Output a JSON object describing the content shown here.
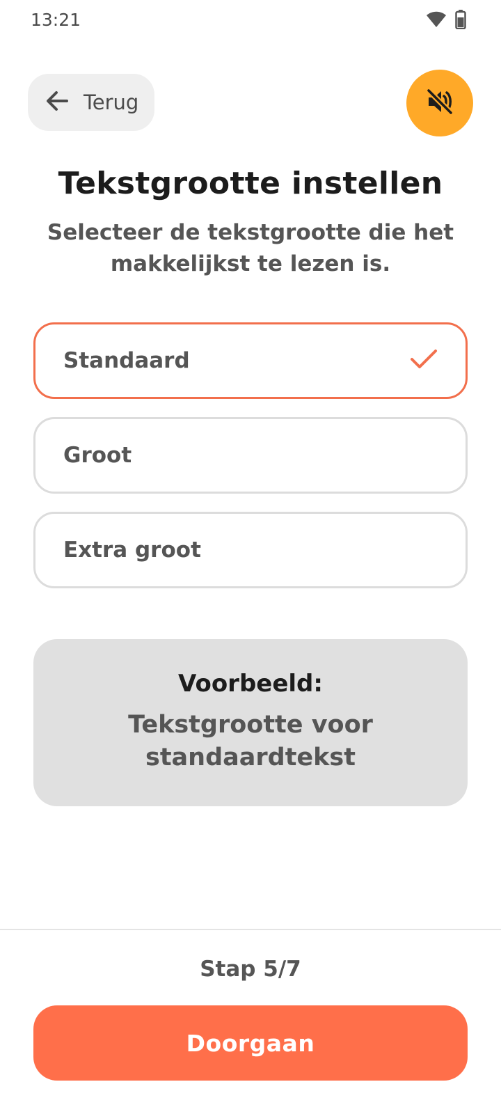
{
  "status_bar": {
    "time": "13:21",
    "icons": [
      "wifi-icon",
      "battery-icon"
    ]
  },
  "header": {
    "back_label": "Terug",
    "back_icon": "arrow-left-icon",
    "mute_icon": "volume-off-icon"
  },
  "title": "Tekstgrootte instellen",
  "subtitle": "Selecteer de tekstgrootte die het makkelijkst te lezen is.",
  "options": [
    {
      "label": "Standaard",
      "selected": true
    },
    {
      "label": "Groot",
      "selected": false
    },
    {
      "label": "Extra groot",
      "selected": false
    }
  ],
  "preview": {
    "title": "Voorbeeld:",
    "text": "Tekstgrootte voor standaardtekst"
  },
  "footer": {
    "step": "Stap 5/7",
    "continue_label": "Doorgaan"
  },
  "colors": {
    "accent": "#ff6f4a",
    "selected_border": "#f26f4c",
    "mute_button": "#ffa928",
    "preview_bg": "#e0e0e0"
  }
}
